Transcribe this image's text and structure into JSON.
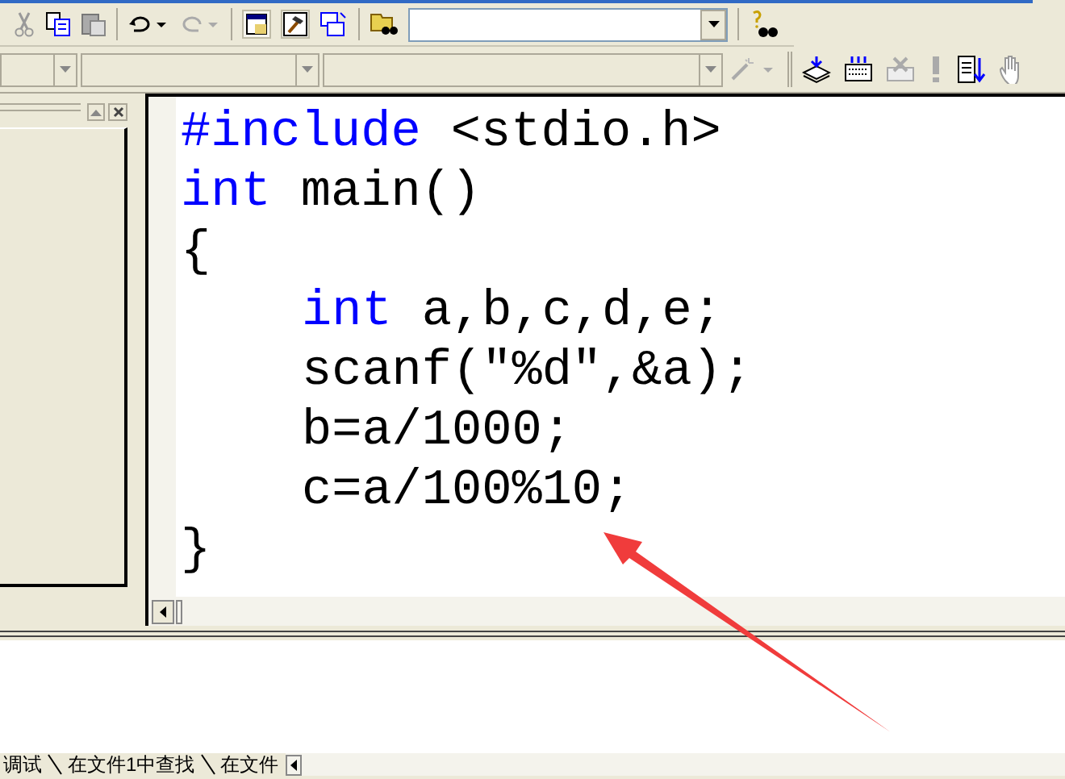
{
  "editor": {
    "lines": [
      {
        "indented": false,
        "segments": [
          {
            "kind": "keyword",
            "text": "#include"
          },
          {
            "kind": "plain",
            "text": " <stdio.h>"
          }
        ]
      },
      {
        "indented": false,
        "segments": [
          {
            "kind": "keyword",
            "text": "int"
          },
          {
            "kind": "plain",
            "text": " main()"
          }
        ]
      },
      {
        "indented": false,
        "segments": [
          {
            "kind": "plain",
            "text": "{"
          }
        ]
      },
      {
        "indented": true,
        "segments": [
          {
            "kind": "keyword",
            "text": "int"
          },
          {
            "kind": "plain",
            "text": " a,b,c,d,e;"
          }
        ]
      },
      {
        "indented": true,
        "segments": [
          {
            "kind": "plain",
            "text": "scanf(\"%d\",&a);"
          }
        ]
      },
      {
        "indented": true,
        "segments": [
          {
            "kind": "plain",
            "text": "b=a/1000;"
          }
        ]
      },
      {
        "indented": true,
        "segments": [
          {
            "kind": "plain",
            "text": "c=a/100%10;"
          }
        ]
      },
      {
        "indented": false,
        "segments": [
          {
            "kind": "plain",
            "text": "}"
          }
        ]
      }
    ]
  },
  "output_tabs": [
    {
      "label": "调试"
    },
    {
      "label": "在文件1中查找"
    },
    {
      "label": "在文件"
    }
  ]
}
